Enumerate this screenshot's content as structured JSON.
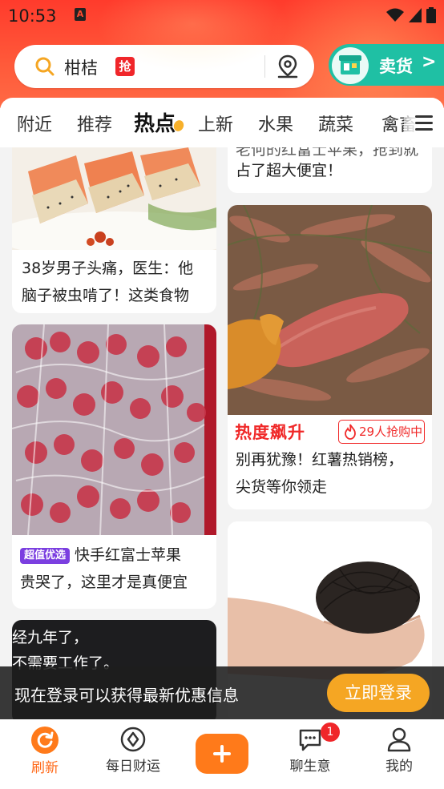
{
  "status_bar": {
    "time": "10:53",
    "app_icon": "A"
  },
  "search": {
    "term": "柑桔",
    "badge": "抢",
    "icons": [
      "search-icon",
      "location-pin-icon"
    ]
  },
  "sell_button": {
    "label": "卖货",
    "arrow": ">"
  },
  "tabs": [
    {
      "label": "附近"
    },
    {
      "label": "推荐"
    },
    {
      "label": "热点",
      "active": true
    },
    {
      "label": "上新"
    },
    {
      "label": "水果"
    },
    {
      "label": "蔬菜"
    },
    {
      "label": "禽畜"
    }
  ],
  "feed": {
    "card_right_top": {
      "title": "占了超大便宜！",
      "partial_line": "老何的红富士苹果，抢到就"
    },
    "card_left_1": {
      "title_line1": "38岁男子头痛，医生：他",
      "title_line2": "脑子被虫啃了！这类食物"
    },
    "card_right_sweetpotato": {
      "hot_label": "热度飙升",
      "buying": "29人抢购中",
      "title_line1": "别再犹豫！红薯热销榜，",
      "title_line2": "尖货等你领走"
    },
    "card_left_apple": {
      "tag": "超值优选",
      "title_line1": "快手红富士苹果",
      "title_line2": "贵哭了，这里才是真便宜"
    },
    "card_left_dark": {
      "line1": "经九年了，",
      "line2": "不需要工作了。"
    }
  },
  "login_banner": {
    "message": "现在登录可以获得最新优惠信息",
    "button": "立即登录"
  },
  "bottom_nav": [
    {
      "label": "刷新",
      "icon": "refresh-icon",
      "active": true
    },
    {
      "label": "每日财运",
      "icon": "compass-icon"
    },
    {
      "label": "",
      "icon": "plus-icon"
    },
    {
      "label": "聊生意",
      "icon": "chat-icon",
      "badge": "1"
    },
    {
      "label": "我的",
      "icon": "person-icon"
    }
  ],
  "colors": {
    "header": "#ff3b2c",
    "accent_orange": "#ff7a1a",
    "sell_green": "#1fc0a4",
    "hot_red": "#f02828",
    "tag_purple": "#7b3fe0"
  }
}
